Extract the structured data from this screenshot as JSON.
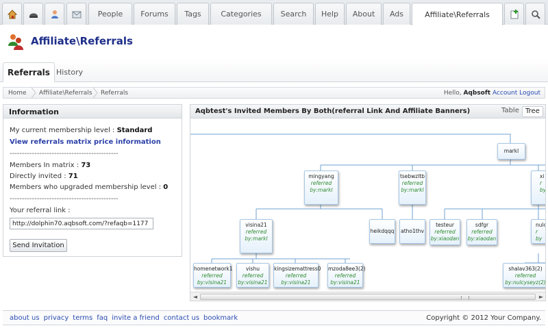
{
  "nav": {
    "tabs": [
      "People",
      "Forums",
      "Tags",
      "Categories",
      "Search",
      "Help",
      "About",
      "Ads",
      "Affiliate\\Referrals"
    ]
  },
  "header": {
    "title": "Affiliate\\Referrals"
  },
  "subtabs": {
    "active": "Referrals",
    "other": "History"
  },
  "breadcrumb": {
    "items": [
      "Home",
      "Affiliate\\Referrals",
      "Referrals"
    ],
    "hello": "Hello,",
    "username": "Aqbsoft",
    "account_link": "Account",
    "logout_link": "Logout"
  },
  "info": {
    "title": "Information",
    "membership_label": "My current membership level :",
    "membership_value": "Standard",
    "matrix_link": "View referrals matrix price information",
    "separator": "--------------------------------------------",
    "members_matrix_label": "Members In matrix :",
    "members_matrix_value": "73",
    "directly_label": "Directly invited :",
    "directly_value": "71",
    "upgraded_label": "Members who upgraded membership level :",
    "upgraded_value": "0",
    "referral_label": "Your referral link :",
    "referral_value": "http://dolphin70.aqbsoft.com/?refaqb=1177",
    "send_button": "Send Invitation"
  },
  "tree": {
    "title": "Aqbtest's Invited Members By Both(referral Link And Affiliate Banners)",
    "view_table": "Table",
    "view_tree": "Tree",
    "nodes": {
      "markl": {
        "name": "markl"
      },
      "mingyang": {
        "name": "mingyang",
        "ref1": "referred",
        "ref2": "by:markl"
      },
      "tsebwzltb": {
        "name": "tsebwzltb",
        "ref1": "referred",
        "ref2": "by:markl"
      },
      "xi": {
        "name": "xi",
        "ref1": "r",
        "ref2": "by"
      },
      "visina21": {
        "name": "visina21",
        "ref1": "referred",
        "ref2": "by:markl"
      },
      "heikdqqq": {
        "name": "heikdqqq"
      },
      "atho1thv": {
        "name": "atho1thv"
      },
      "testeur": {
        "name": "testeur",
        "ref1": "referred",
        "ref2": "by:xiaodan"
      },
      "sdfgr": {
        "name": "sdfgr",
        "ref1": "referred",
        "ref2": "by:xiaodan"
      },
      "nulcy": {
        "name": "nulcy",
        "ref1": "r",
        "ref2": "by"
      },
      "homenetwork1": {
        "name": "homenetwork1",
        "ref1": "referred",
        "ref2": "by:visina21"
      },
      "vishu": {
        "name": "vishu",
        "ref1": "referred",
        "ref2": "by:visina21"
      },
      "kingsize": {
        "name": "kingsizemattress0",
        "ref1": "referred",
        "ref2": "by:visina21"
      },
      "mzoda": {
        "name": "mzoda8ee3(2)",
        "ref1": "referred",
        "ref2": "by:visina21"
      },
      "shalav": {
        "name": "shalav363(2)",
        "ref1": "referred",
        "ref2": "by:nulcyseyz(2)"
      }
    }
  },
  "footer": {
    "links": [
      "about us",
      "privacy",
      "terms",
      "faq",
      "invite a friend",
      "contact us",
      "bookmark"
    ],
    "copyright": "Copyright © 2012 Your Company."
  }
}
